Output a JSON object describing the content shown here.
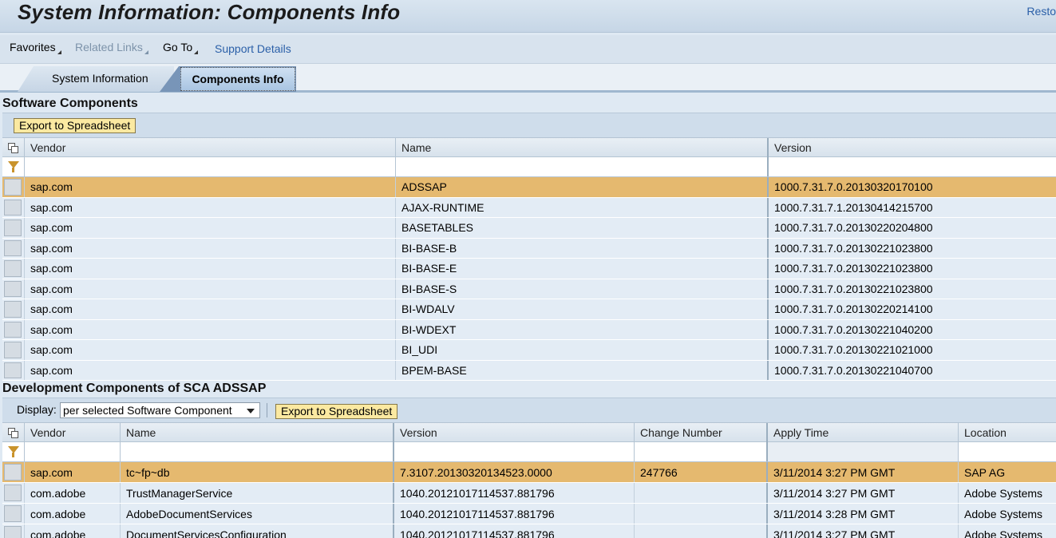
{
  "window": {
    "title": "System Information: Components Info",
    "restore_label": "Resto"
  },
  "menubar": {
    "favorites": "Favorites",
    "related_links": "Related Links",
    "go_to": "Go To",
    "support_details": "Support Details"
  },
  "tabs": [
    {
      "label": "System Information",
      "active": false
    },
    {
      "label": "Components Info",
      "active": true
    }
  ],
  "software_components": {
    "heading": "Software Components",
    "export_label": "Export to Spreadsheet",
    "columns": [
      "Vendor",
      "Name",
      "Version"
    ],
    "rows": [
      {
        "vendor": "sap.com",
        "name": "ADSSAP",
        "version": "1000.7.31.7.0.20130320170100",
        "selected": true
      },
      {
        "vendor": "sap.com",
        "name": "AJAX-RUNTIME",
        "version": "1000.7.31.7.1.20130414215700"
      },
      {
        "vendor": "sap.com",
        "name": "BASETABLES",
        "version": "1000.7.31.7.0.20130220204800"
      },
      {
        "vendor": "sap.com",
        "name": "BI-BASE-B",
        "version": "1000.7.31.7.0.20130221023800"
      },
      {
        "vendor": "sap.com",
        "name": "BI-BASE-E",
        "version": "1000.7.31.7.0.20130221023800"
      },
      {
        "vendor": "sap.com",
        "name": "BI-BASE-S",
        "version": "1000.7.31.7.0.20130221023800"
      },
      {
        "vendor": "sap.com",
        "name": "BI-WDALV",
        "version": "1000.7.31.7.0.20130220214100"
      },
      {
        "vendor": "sap.com",
        "name": "BI-WDEXT",
        "version": "1000.7.31.7.0.20130221040200"
      },
      {
        "vendor": "sap.com",
        "name": "BI_UDI",
        "version": "1000.7.31.7.0.20130221021000"
      },
      {
        "vendor": "sap.com",
        "name": "BPEM-BASE",
        "version": "1000.7.31.7.0.20130221040700"
      }
    ]
  },
  "development_components": {
    "heading": "Development Components of SCA ADSSAP",
    "display_label": "Display:",
    "display_value": "per selected Software Component",
    "export_label": "Export to Spreadsheet",
    "columns": [
      "Vendor",
      "Name",
      "Version",
      "Change Number",
      "Apply Time",
      "Location"
    ],
    "rows": [
      {
        "vendor": "sap.com",
        "name": "tc~fp~db",
        "version": "7.3107.20130320134523.0000",
        "change": "247766",
        "apply": "3/11/2014 3:27 PM GMT",
        "location": "SAP AG",
        "selected": true
      },
      {
        "vendor": "com.adobe",
        "name": "TrustManagerService",
        "version": "1040.20121017114537.881796",
        "change": "",
        "apply": "3/11/2014 3:27 PM GMT",
        "location": "Adobe Systems"
      },
      {
        "vendor": "com.adobe",
        "name": "AdobeDocumentServices",
        "version": "1040.20121017114537.881796",
        "change": "",
        "apply": "3/11/2014 3:28 PM GMT",
        "location": "Adobe Systems"
      },
      {
        "vendor": "com.adobe",
        "name": "DocumentServicesConfiguration",
        "version": "1040.20121017114537.881796",
        "change": "",
        "apply": "3/11/2014 3:27 PM GMT",
        "location": "Adobe Systems"
      }
    ]
  },
  "icons": {
    "column_config": "column-config-icon",
    "filter": "filter-icon",
    "dropdown": "chevron-down-icon"
  }
}
